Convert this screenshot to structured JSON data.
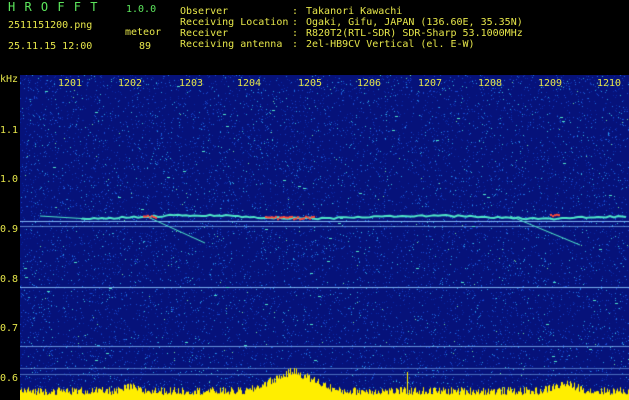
{
  "header": {
    "app_name": "H R O F F T",
    "version": "1.0.0",
    "filename": "2511151200.png",
    "datetime": "25.11.15 12:00",
    "mode_label": "meteor",
    "count": "89",
    "info_labels": [
      "Observer",
      "Receiving Location",
      "Receiver",
      "Receiving antenna"
    ],
    "info_separator": ":",
    "info_values": [
      "Takanori Kawachi",
      "Ogaki, Gifu, JAPAN (136.60E, 35.35N)",
      "R820T2(RTL-SDR) SDR-Sharp 53.1000MHz",
      "2el-HB9CV Vertical (el. E-W)"
    ]
  },
  "spectrogram": {
    "y_unit": "kHz",
    "y_ticks": [
      "1.1",
      "1.0",
      "0.9",
      "0.8",
      "0.7",
      "0.6"
    ],
    "x_ticks": [
      "1201",
      "1202",
      "1203",
      "1204",
      "1205",
      "1206",
      "1207",
      "1208",
      "1209",
      "1210"
    ],
    "colors": {
      "background": "#06127a",
      "noise": [
        "#0a2aa8",
        "#1848d0",
        "#1d6fe0",
        "#28a0e8",
        "#3bc8d8",
        "#6fe0a0"
      ],
      "trace": "#4ee6c8",
      "echo": "#ff4a3a",
      "carrier": "#8ec8ff",
      "baseline": "#ffee00",
      "text": "#e6e64a"
    }
  }
}
